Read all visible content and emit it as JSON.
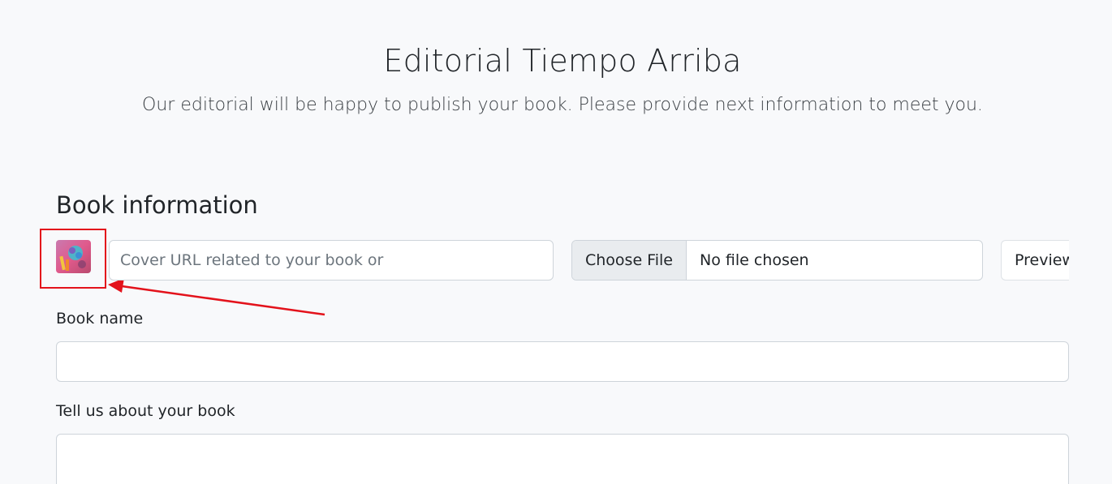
{
  "header": {
    "title": "Editorial Tiempo Arriba",
    "subtitle": "Our editorial will be happy to publish your book. Please provide next information to meet you."
  },
  "book_info": {
    "section_title": "Book information",
    "cover_url_placeholder": "Cover URL related to your book or",
    "cover_url_value": "",
    "file_button_label": "Choose File",
    "file_status": "No file chosen",
    "preview_label": "Preview",
    "book_name_label": "Book name",
    "book_name_value": "",
    "about_label": "Tell us about your book",
    "about_value": ""
  },
  "annotation": {
    "highlight_color": "#e3121b"
  },
  "colors": {
    "background": "#f8f9fb",
    "input_border": "#ced4da",
    "file_button_bg": "#e9ecef"
  }
}
